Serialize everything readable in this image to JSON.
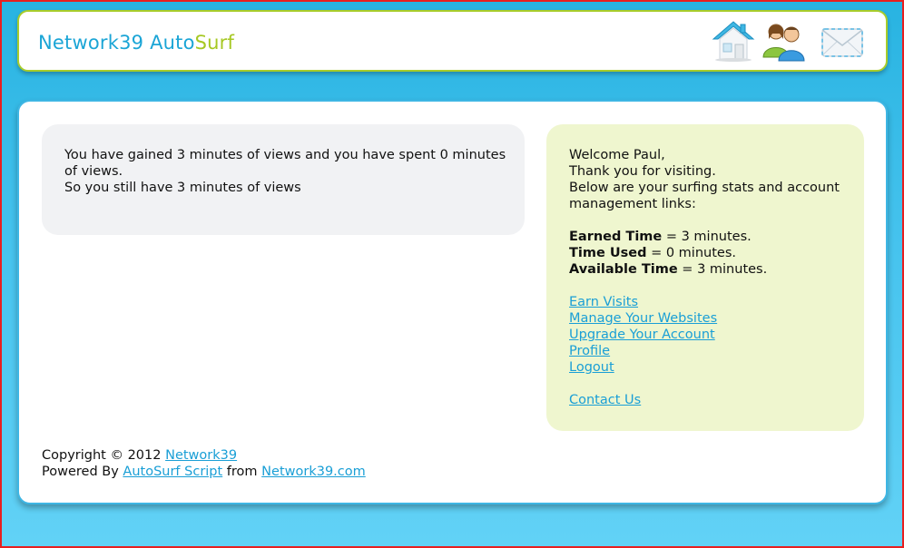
{
  "header": {
    "logo_main": "Network39 Auto",
    "logo_accent": "Surf",
    "icons": [
      "home-icon",
      "users-icon",
      "mail-icon"
    ]
  },
  "stats": {
    "line1": "You have gained 3 minutes of views and you have spent 0 minutes of views.",
    "line2": "So you still have 3 minutes of views"
  },
  "sidebar": {
    "welcome": "Welcome Paul,",
    "thanks": "Thank you for visiting.",
    "intro": "Below are your surfing stats and account management links:",
    "earned_label": "Earned Time",
    "earned_value": " = 3 minutes.",
    "used_label": "Time Used",
    "used_value": " = 0 minutes.",
    "available_label": "Available Time",
    "available_value": " = 3 minutes.",
    "links": {
      "earn_visits": "Earn Visits",
      "manage_websites": "Manage Your Websites",
      "upgrade_account": "Upgrade Your Account",
      "profile": "Profile",
      "logout": "Logout",
      "contact_us": "Contact Us"
    }
  },
  "footer": {
    "copyright": "Copyright © 2012 ",
    "copyright_link": "Network39",
    "powered_by": "Powered By ",
    "script_link": "AutoSurf Script",
    "from": " from ",
    "site_link": "Network39.com"
  },
  "colors": {
    "brand_blue": "#1ba5d6",
    "brand_green": "#a6c823",
    "link": "#1a9fd6",
    "background": "#46c3ee",
    "sidebar_bg": "#eff6cf"
  }
}
